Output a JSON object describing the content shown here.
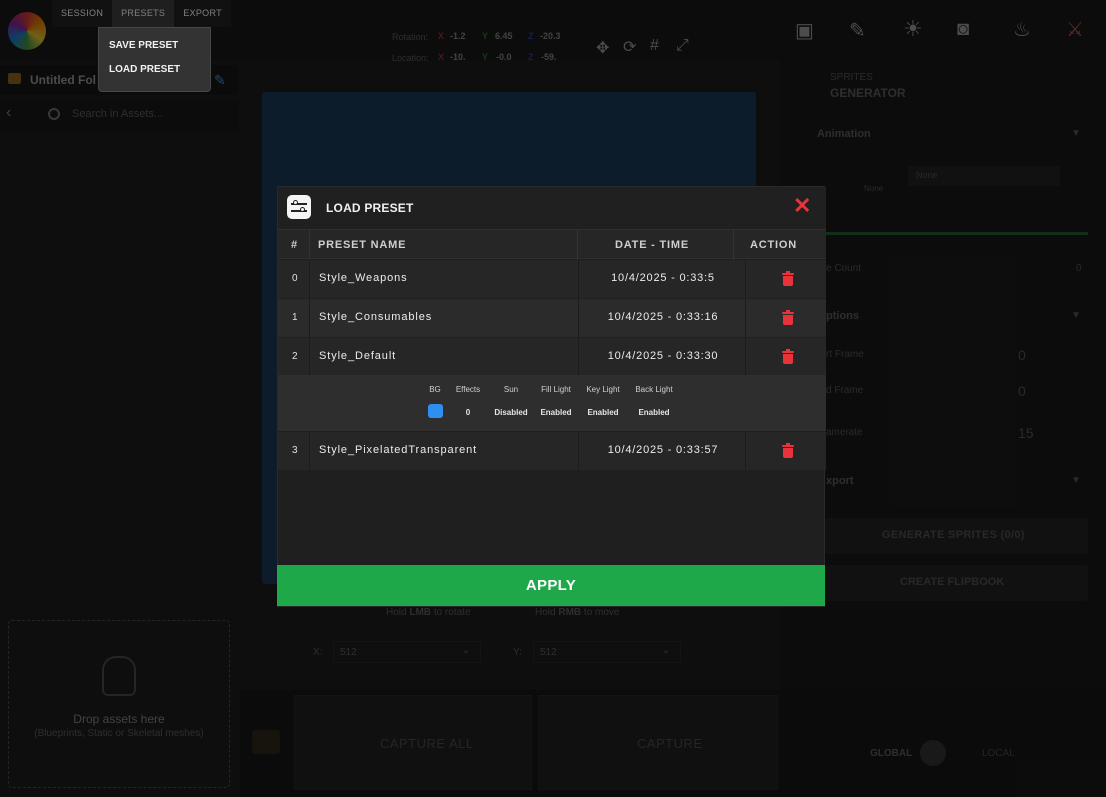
{
  "menu": {
    "items": [
      "SESSION",
      "PRESETS",
      "EXPORT"
    ],
    "dropdown": [
      "SAVE PRESET",
      "LOAD PRESET"
    ]
  },
  "sidebar": {
    "folder_name": "Untitled Fol",
    "search_placeholder": "Search in Assets...",
    "drop_title": "Drop assets here",
    "drop_subtitle": "(Blueprints, Static or Skeletal meshes)"
  },
  "transform": {
    "rotation_label": "Rotation:",
    "location_label": "Location:",
    "rotation": {
      "x": "-1.2",
      "y": "6.45",
      "z": "-20.3"
    },
    "location": {
      "x": "-10.",
      "y": "-0.0",
      "z": "-59."
    },
    "axis_x": "X",
    "axis_y": "Y",
    "axis_z": "Z"
  },
  "viewport": {
    "hint_rotate_pre": "Hold",
    "hint_rotate_key": "LMB",
    "hint_rotate_post": "to rotate",
    "hint_move_pre": "Hold",
    "hint_move_key": "RMB",
    "hint_move_post": "to move"
  },
  "resolution": {
    "x_label": "X:",
    "x_value": "512",
    "y_label": "Y:",
    "y_value": "512"
  },
  "capture": {
    "all_label": "CAPTURE ALL",
    "single_label": "CAPTURE"
  },
  "space_toggle": {
    "global": "GLOBAL",
    "local": "LOCAL"
  },
  "right_panel": {
    "tool_title_1": "SPRITES",
    "tool_title_2": "GENERATOR",
    "animation_label": "Animation",
    "anim_dropdown": "None",
    "anim_none": "None",
    "frame_count_label": "e Count",
    "frame_count_value": "0",
    "options_label": "ptions",
    "start_frame_label": "rt Frame",
    "start_frame_value": "0",
    "end_frame_label": "d Frame",
    "end_frame_value": "0",
    "framerate_label": "amerate",
    "framerate_value": "15",
    "export_label": "xport",
    "generate_label": "GENERATE SPRITES",
    "generate_count": "(0/0)",
    "flipbook_label": "CREATE FLIPBOOK"
  },
  "modal": {
    "title": "LOAD PRESET",
    "columns": [
      "#",
      "PRESET NAME",
      "DATE - TIME",
      "ACTION"
    ],
    "rows": [
      {
        "index": "0",
        "name": "Style_Weapons",
        "datetime": "10/4/2025 - 0:33:5"
      },
      {
        "index": "1",
        "name": "Style_Consumables",
        "datetime": "10/4/2025 - 0:33:16"
      },
      {
        "index": "2",
        "name": "Style_Default",
        "datetime": "10/4/2025 - 0:33:30"
      },
      {
        "index": "3",
        "name": "Style_PixelatedTransparent",
        "datetime": "10/4/2025 - 0:33:57"
      }
    ],
    "detail": {
      "headers": [
        "BG",
        "Effects",
        "Sun",
        "Fill Light",
        "Key Light",
        "Back Light"
      ],
      "values": [
        "",
        "0",
        "Disabled",
        "Enabled",
        "Enabled",
        "Enabled"
      ],
      "bg_color": "#2f8ff0"
    },
    "apply_label": "APPLY"
  },
  "colors": {
    "accent_green": "#1ea84a",
    "danger_red": "#e8333a",
    "link_blue": "#3d7fd6"
  }
}
